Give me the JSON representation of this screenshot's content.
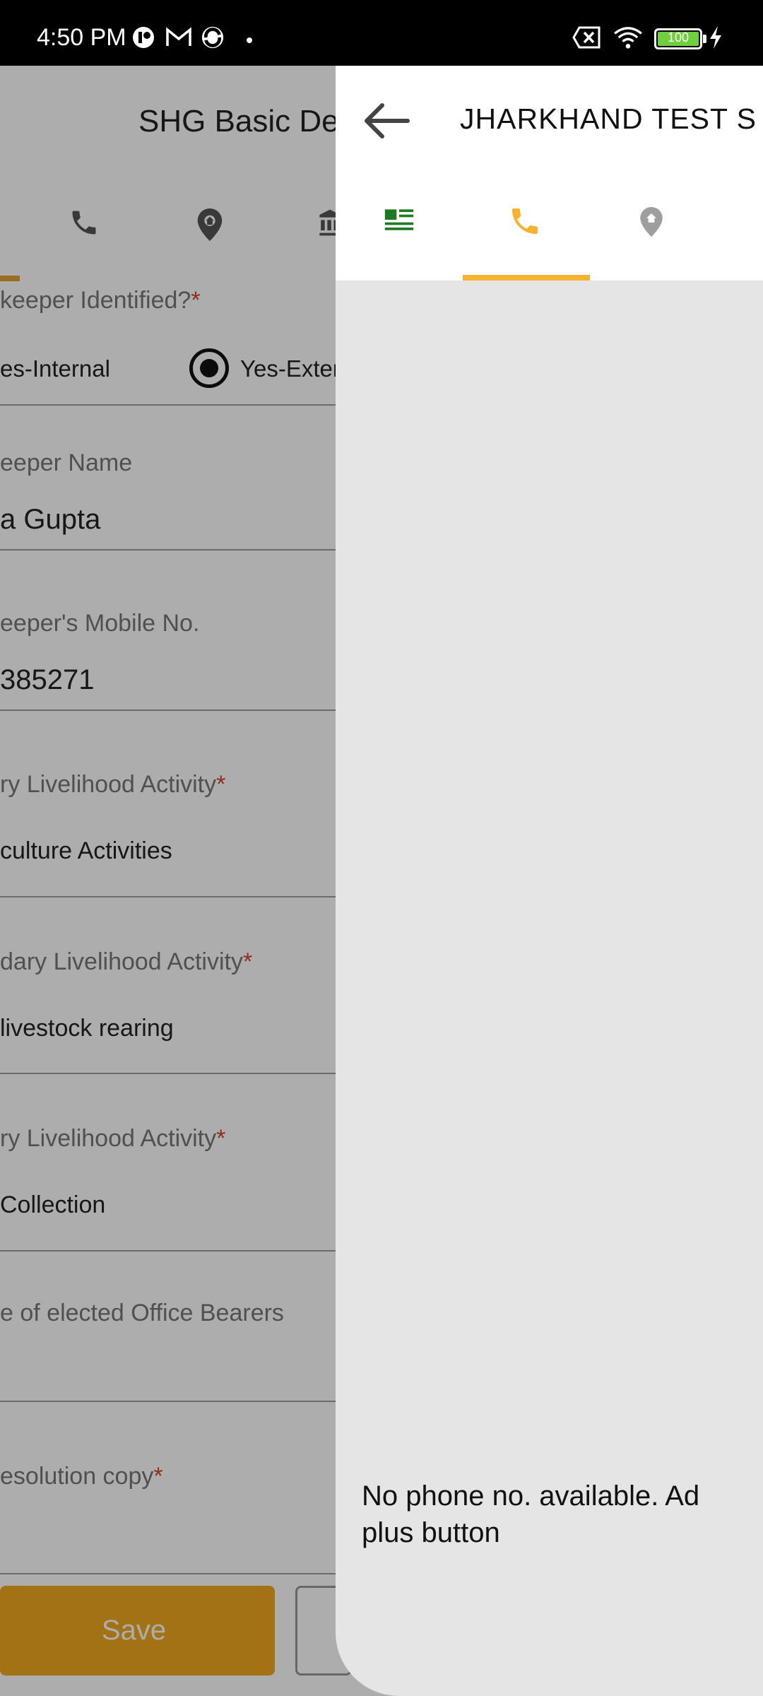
{
  "status_bar": {
    "time": "4:50 PM",
    "battery": "100",
    "icons": [
      "notification-app-icon",
      "gmail-icon",
      "app-icon",
      "notification-dot",
      "sim-off-icon",
      "wifi-icon",
      "battery-icon",
      "charging-icon"
    ]
  },
  "background_screen": {
    "title": "SHG Basic De",
    "tabs": [
      "details-tab-icon",
      "phone-icon",
      "location-pin-icon",
      "bank-icon"
    ],
    "fields": {
      "bookkeeper_identified": {
        "label": "keeper Identified?",
        "required": "*"
      },
      "radio_internal": "es-Internal",
      "radio_external": "Yes-Exter",
      "bookkeeper_name": {
        "label": "eeper Name",
        "value": "a Gupta"
      },
      "bookkeeper_mobile": {
        "label": "eeper's Mobile No.",
        "value": "385271"
      },
      "primary_livelihood": {
        "label": "ry Livelihood Activity",
        "required": "*",
        "value": "culture Activities"
      },
      "secondary_livelihood": {
        "label": "dary Livelihood Activity",
        "required": "*",
        "value": "livestock rearing"
      },
      "tertiary_livelihood": {
        "label": "ry Livelihood Activity",
        "required": "*",
        "value": "Collection"
      },
      "office_bearers": {
        "label": "e of elected Office Bearers"
      },
      "resolution_copy": {
        "label": "esolution copy",
        "required": "*"
      }
    },
    "save_label": "Save"
  },
  "drawer": {
    "title": "JHARKHAND TEST S",
    "tabs": [
      "details-tab-icon",
      "phone-icon",
      "location-pin-icon"
    ],
    "active_tab": 1,
    "empty_message": "No phone no. available. Ad\nplus button"
  },
  "colors": {
    "accent": "#f0a81e",
    "active_tab": "#f5b330",
    "required": "#d3452f",
    "green_icon": "#1e8a2a"
  }
}
